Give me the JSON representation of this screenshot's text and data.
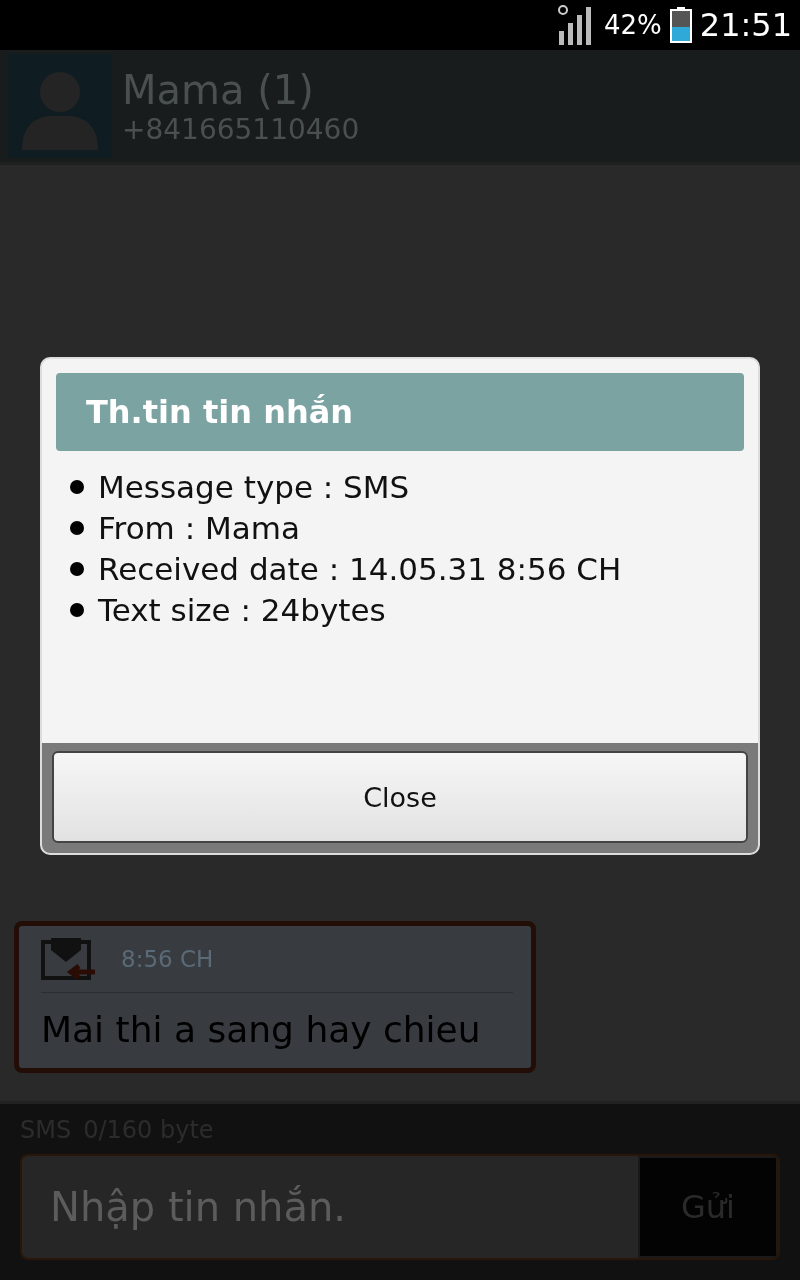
{
  "status_bar": {
    "battery_percent": "42%",
    "time": "21:51"
  },
  "contact": {
    "name": "Mama (1)",
    "number": "+841665110460"
  },
  "message": {
    "time": "8:56 CH",
    "text": "Mai thi a sang hay chieu"
  },
  "composer": {
    "type": "SMS",
    "counter": "0/160 byte",
    "placeholder": "Nhập tin nhắn.",
    "send": "Gửi"
  },
  "dialog": {
    "title": "Th.tin tin nhắn",
    "details": [
      "Message type : SMS",
      "From : Mama",
      "Received date : 14.05.31 8:56 CH",
      "Text size : 24bytes"
    ],
    "button": "Close"
  }
}
